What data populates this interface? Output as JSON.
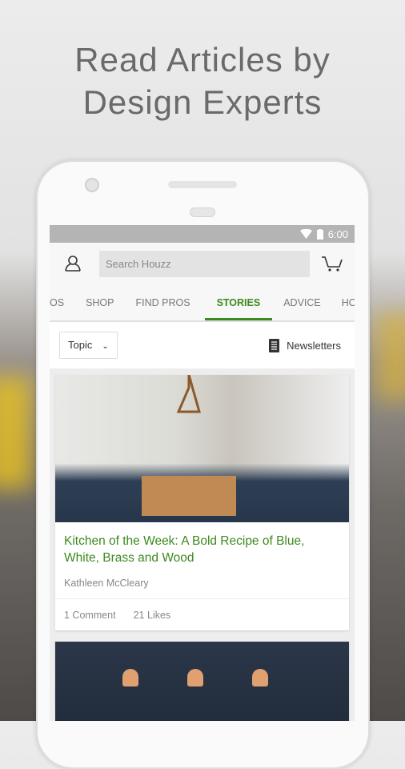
{
  "headline": {
    "line1": "Read Articles by",
    "line2": "Design Experts"
  },
  "status_bar": {
    "time": "6:00"
  },
  "header": {
    "search_placeholder": "Search Houzz"
  },
  "tabs": [
    {
      "label": "OS"
    },
    {
      "label": "SHOP"
    },
    {
      "label": "FIND PROS"
    },
    {
      "label": "STORIES",
      "active": true
    },
    {
      "label": "ADVICE"
    },
    {
      "label": "HOU"
    }
  ],
  "filter": {
    "topic_label": "Topic",
    "newsletters_label": "Newsletters"
  },
  "articles": [
    {
      "title": "Kitchen of the Week: A Bold Recipe of Blue, White, Brass and Wood",
      "author": "Kathleen McCleary",
      "comments": "1 Comment",
      "likes": "21 Likes"
    }
  ],
  "colors": {
    "accent": "#3d8a1e",
    "status_bar": "#b4b4b4"
  }
}
